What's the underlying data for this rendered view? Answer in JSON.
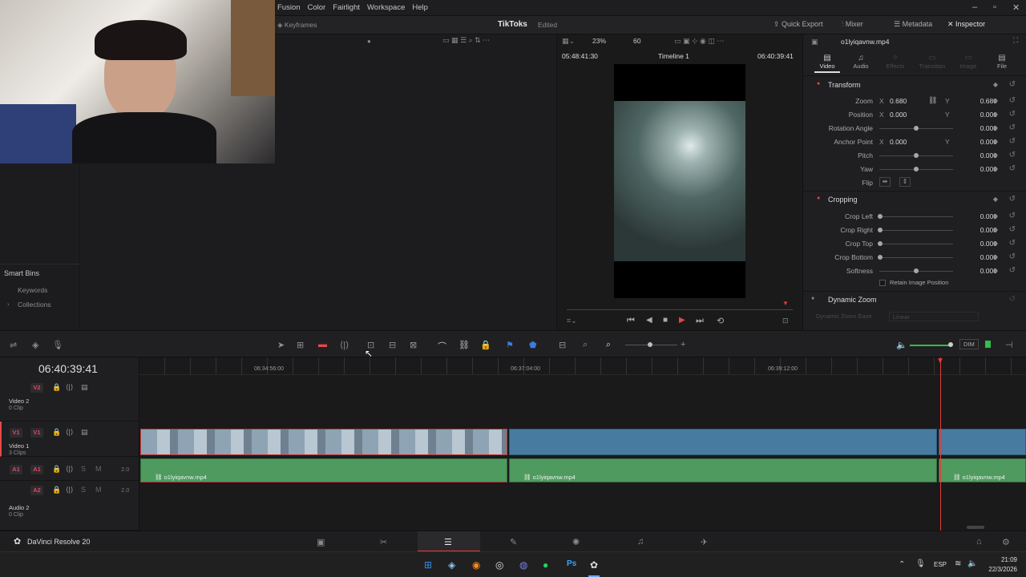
{
  "menubar": {
    "items": [
      "Fusion",
      "Color",
      "Fairlight",
      "Workspace",
      "Help"
    ]
  },
  "header": {
    "project_name": "TikToks",
    "project_status": "Edited",
    "keyframes_label": "Keyframes",
    "quick_export": "Quick Export",
    "mixer": "Mixer",
    "metadata": "Metadata",
    "inspector": "Inspector"
  },
  "viewer": {
    "zoom": "23%",
    "fps": "60",
    "timecode_left": "05:48:41:30",
    "timeline_name": "Timeline 1",
    "timecode_right": "06:40:39:41"
  },
  "mediapool": {
    "smart_bins": "Smart Bins",
    "keywords": "Keywords",
    "collections": "Collections"
  },
  "inspector": {
    "file_name": "o1lyiqavnw.mp4",
    "tabs": [
      "Video",
      "Audio",
      "Effects",
      "Transition",
      "Image",
      "File"
    ],
    "transform": {
      "title": "Transform",
      "zoom_label": "Zoom",
      "zoom_x": "0.680",
      "zoom_y": "0.680",
      "position_label": "Position",
      "position_x": "0.000",
      "position_y": "0.000",
      "rotation_label": "Rotation Angle",
      "rotation": "0.000",
      "anchor_label": "Anchor Point",
      "anchor_x": "0.000",
      "anchor_y": "0.000",
      "pitch_label": "Pitch",
      "pitch": "0.000",
      "yaw_label": "Yaw",
      "yaw": "0.000",
      "flip_label": "Flip",
      "x": "X",
      "y": "Y"
    },
    "cropping": {
      "title": "Cropping",
      "crop_left_label": "Crop Left",
      "crop_left": "0.000",
      "crop_right_label": "Crop Right",
      "crop_right": "0.000",
      "crop_top_label": "Crop Top",
      "crop_top": "0.000",
      "crop_bottom_label": "Crop Bottom",
      "crop_bottom": "0.000",
      "softness_label": "Softness",
      "softness": "0.000",
      "retain_label": "Retain Image Position"
    },
    "dynamic_zoom": {
      "title": "Dynamic Zoom",
      "ease_label": "Dynamic Zoom Ease",
      "ease_value": "Linear"
    }
  },
  "timeline": {
    "timecode": "06:40:39:41",
    "ruler": [
      "06:34:56:00",
      "06:37:04:00",
      "06:39:12:00"
    ],
    "dim": "DIM",
    "tracks": {
      "v2": {
        "badge": "V2",
        "name": "Video 2",
        "clips": "0 Clip"
      },
      "v1": {
        "badge": "V1",
        "src": "V1",
        "name": "Video 1",
        "clips": "3 Clips"
      },
      "a1": {
        "badge": "A1",
        "src": "A1",
        "name": "",
        "level": "2.0"
      },
      "a2": {
        "badge": "A2",
        "name": "Audio 2",
        "clips": "0 Clip",
        "level": "2.0"
      }
    },
    "audio_clips": [
      "o1lyiqavnw.mp4",
      "o1lyiqavnw.mp4",
      "o1lyiqavnw.mp4"
    ]
  },
  "pagebar": {
    "app_name": "DaVinci Resolve 20"
  },
  "taskbar": {
    "lang": "ESP",
    "time": "21:09",
    "date": "22/3/2026"
  }
}
